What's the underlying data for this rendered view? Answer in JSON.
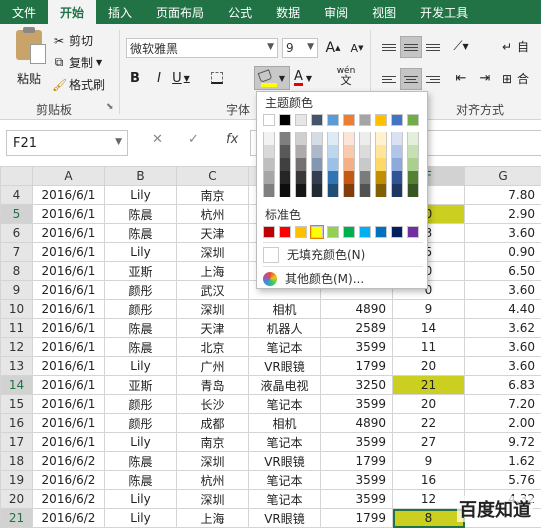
{
  "tabs": [
    "文件",
    "开始",
    "插入",
    "页面布局",
    "公式",
    "数据",
    "审阅",
    "视图",
    "开发工具"
  ],
  "clipboard": {
    "paste": "粘贴",
    "cut": "剪切",
    "copy": "复制",
    "format_painter": "格式刷",
    "group": "剪贴板"
  },
  "font": {
    "name": "微软雅黑",
    "size": "9",
    "grow": "A",
    "shrink": "A",
    "bold": "B",
    "italic": "I",
    "underline": "U",
    "group": "字体",
    "wen": "wén",
    "wen_char": "文"
  },
  "alignment": {
    "group": "对齐方式",
    "wrap": "自",
    "merge": "合"
  },
  "namebox": "F21",
  "fx": "fx",
  "color_menu": {
    "theme_title": "主题颜色",
    "standard_title": "标准色",
    "no_fill": "无填充颜色(N)",
    "more": "其他颜色(M)...",
    "theme_top": [
      "#ffffff",
      "#000000",
      "#e7e6e6",
      "#44546a",
      "#5b9bd5",
      "#ed7d31",
      "#a5a5a5",
      "#ffc000",
      "#4472c4",
      "#70ad47"
    ],
    "theme_shades": [
      [
        "#f2f2f2",
        "#d9d9d9",
        "#bfbfbf",
        "#a6a6a6",
        "#7f7f7f"
      ],
      [
        "#7f7f7f",
        "#595959",
        "#404040",
        "#262626",
        "#0d0d0d"
      ],
      [
        "#d0cece",
        "#aeaaaa",
        "#757171",
        "#3a3838",
        "#171616"
      ],
      [
        "#d6dce4",
        "#adb9ca",
        "#8497b0",
        "#333f4f",
        "#222a35"
      ],
      [
        "#ddebf7",
        "#bdd7ee",
        "#9bc2e6",
        "#2f75b5",
        "#1f4e78"
      ],
      [
        "#fce4d6",
        "#f8cbad",
        "#f4b084",
        "#c65911",
        "#833c0c"
      ],
      [
        "#ededed",
        "#dbdbdb",
        "#c9c9c9",
        "#7b7b7b",
        "#525252"
      ],
      [
        "#fff2cc",
        "#ffe699",
        "#ffd966",
        "#bf8f00",
        "#806000"
      ],
      [
        "#d9e1f2",
        "#b4c6e7",
        "#8ea9db",
        "#305496",
        "#203764"
      ],
      [
        "#e2efda",
        "#c6e0b4",
        "#a9d08e",
        "#548235",
        "#375623"
      ]
    ],
    "standard": [
      "#c00000",
      "#ff0000",
      "#ffc000",
      "#ffff00",
      "#92d050",
      "#00b050",
      "#00b0f0",
      "#0070c0",
      "#002060",
      "#7030a0"
    ]
  },
  "columns": [
    "A",
    "B",
    "C",
    "D",
    "E",
    "F",
    "G"
  ],
  "rows": [
    {
      "n": "4",
      "a": "2016/6/1",
      "b": "Lily",
      "c": "南京",
      "d": "",
      "e": "",
      "f": "",
      "g": "7.80"
    },
    {
      "n": "5",
      "a": "2016/6/1",
      "b": "陈晨",
      "c": "杭州",
      "d": "",
      "e": "",
      "f": "0",
      "g": "2.90",
      "hl": true
    },
    {
      "n": "6",
      "a": "2016/6/1",
      "b": "陈晨",
      "c": "天津",
      "d": "",
      "e": "",
      "f": "3",
      "g": "3.60"
    },
    {
      "n": "7",
      "a": "2016/6/1",
      "b": "Lily",
      "c": "深圳",
      "d": "",
      "e": "",
      "f": "5",
      "g": "0.90"
    },
    {
      "n": "8",
      "a": "2016/6/1",
      "b": "亚斯",
      "c": "上海",
      "d": "",
      "e": "",
      "f": "0",
      "g": "6.50"
    },
    {
      "n": "9",
      "a": "2016/6/1",
      "b": "颜彤",
      "c": "武汉",
      "d": "",
      "e": "",
      "f": "0",
      "g": "3.60"
    },
    {
      "n": "10",
      "a": "2016/6/1",
      "b": "颜彤",
      "c": "深圳",
      "d": "相机",
      "e": "4890",
      "f": "9",
      "g": "4.40"
    },
    {
      "n": "11",
      "a": "2016/6/1",
      "b": "陈晨",
      "c": "天津",
      "d": "机器人",
      "e": "2589",
      "f": "14",
      "g": "3.62"
    },
    {
      "n": "12",
      "a": "2016/6/1",
      "b": "陈晨",
      "c": "北京",
      "d": "笔记本",
      "e": "3599",
      "f": "11",
      "g": "3.60"
    },
    {
      "n": "13",
      "a": "2016/6/1",
      "b": "Lily",
      "c": "广州",
      "d": "VR眼镜",
      "e": "1799",
      "f": "20",
      "g": "3.60"
    },
    {
      "n": "14",
      "a": "2016/6/1",
      "b": "亚斯",
      "c": "青岛",
      "d": "液晶电视",
      "e": "3250",
      "f": "21",
      "g": "6.83",
      "hl": true
    },
    {
      "n": "15",
      "a": "2016/6/1",
      "b": "颜彤",
      "c": "长沙",
      "d": "笔记本",
      "e": "3599",
      "f": "20",
      "g": "7.20"
    },
    {
      "n": "16",
      "a": "2016/6/1",
      "b": "颜彤",
      "c": "成都",
      "d": "相机",
      "e": "4890",
      "f": "22",
      "g": "2.00"
    },
    {
      "n": "17",
      "a": "2016/6/1",
      "b": "Lily",
      "c": "南京",
      "d": "笔记本",
      "e": "3599",
      "f": "27",
      "g": "9.72"
    },
    {
      "n": "18",
      "a": "2016/6/2",
      "b": "陈晨",
      "c": "深圳",
      "d": "VR眼镜",
      "e": "1799",
      "f": "9",
      "g": "1.62"
    },
    {
      "n": "19",
      "a": "2016/6/2",
      "b": "陈晨",
      "c": "杭州",
      "d": "笔记本",
      "e": "3599",
      "f": "16",
      "g": "5.76"
    },
    {
      "n": "20",
      "a": "2016/6/2",
      "b": "Lily",
      "c": "深圳",
      "d": "笔记本",
      "e": "3599",
      "f": "12",
      "g": "4.32"
    },
    {
      "n": "21",
      "a": "2016/6/2",
      "b": "Lily",
      "c": "上海",
      "d": "VR眼镜",
      "e": "1799",
      "f": "8",
      "g": "",
      "hl": true,
      "cur": true
    }
  ],
  "watermark": "百度知道"
}
